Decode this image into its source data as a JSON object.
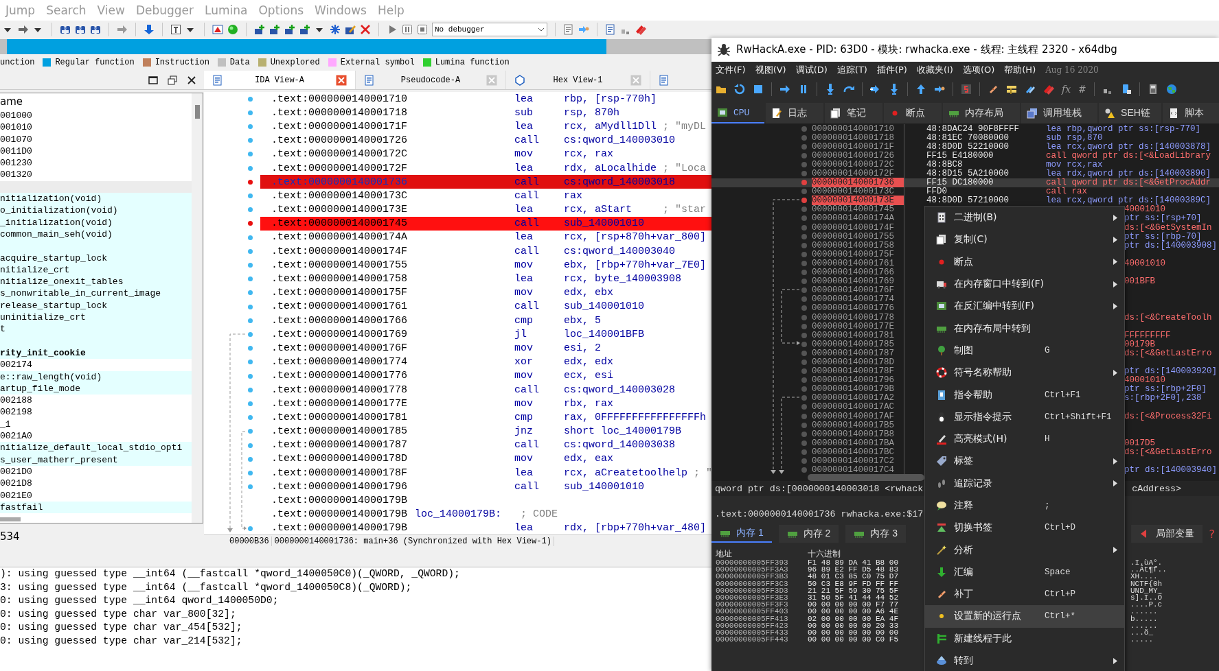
{
  "ida": {
    "menu": [
      "Jump",
      "Search",
      "View",
      "Debugger",
      "Lumina",
      "Options",
      "Windows",
      "Help"
    ],
    "debugger_select": "No debugger",
    "legend": [
      {
        "label": "unction"
      },
      {
        "label": "Regular function",
        "color": "#00a0e0"
      },
      {
        "label": "Instruction",
        "color": "#c0805c"
      },
      {
        "label": "Data",
        "color": "#c0c0c0"
      },
      {
        "label": "Unexplored",
        "color": "#b8b070"
      },
      {
        "label": "External symbol",
        "color": "#ffa8ff"
      },
      {
        "label": "Lumina function",
        "color": "#30d030"
      }
    ],
    "functions_panel": {
      "header": "ame",
      "status": "534",
      "rows": [
        {
          "text": "001000",
          "library": false,
          "selected": false,
          "bold": false
        },
        {
          "text": "001010",
          "library": false,
          "selected": false,
          "bold": false
        },
        {
          "text": "001070",
          "library": false,
          "selected": false,
          "bold": false
        },
        {
          "text": "0011D0",
          "library": false,
          "selected": false,
          "bold": false
        },
        {
          "text": "001230",
          "library": false,
          "selected": false,
          "bold": false
        },
        {
          "text": "001320",
          "library": false,
          "selected": false,
          "bold": false
        },
        {
          "library": false,
          "selected": true,
          "bold": false
        },
        {
          "text": "nitialization(void)",
          "library": true,
          "selected": false,
          "bold": false
        },
        {
          "text": "o_initialization(void)",
          "library": true,
          "selected": false,
          "bold": false
        },
        {
          "text": "_initialization(void)",
          "library": true,
          "selected": false,
          "bold": false
        },
        {
          "text": "common_main_seh(void)",
          "library": true,
          "selected": false,
          "bold": false
        },
        {
          "library": true,
          "selected": false,
          "bold": false
        },
        {
          "text": "acquire_startup_lock",
          "library": true,
          "selected": false,
          "bold": false
        },
        {
          "text": "nitialize_crt",
          "library": true,
          "selected": false,
          "bold": false
        },
        {
          "text": "nitialize_onexit_tables",
          "library": true,
          "selected": false,
          "bold": false
        },
        {
          "text": "s_nonwritable_in_current_image",
          "library": true,
          "selected": false,
          "bold": false
        },
        {
          "text": "release_startup_lock",
          "library": true,
          "selected": false,
          "bold": false
        },
        {
          "text": "uninitialize_crt",
          "library": true,
          "selected": false,
          "bold": false
        },
        {
          "text": "t",
          "library": true,
          "selected": false,
          "bold": false
        },
        {
          "library": true,
          "selected": false,
          "bold": false
        },
        {
          "text": "rity_init_cookie",
          "library": true,
          "selected": false,
          "bold": true
        },
        {
          "text": "002174",
          "library": false,
          "selected": false,
          "bold": false
        },
        {
          "text": "e::raw_length(void)",
          "library": true,
          "selected": false,
          "bold": false
        },
        {
          "text": "artup_file_mode",
          "library": true,
          "selected": false,
          "bold": false
        },
        {
          "text": "002188",
          "library": false,
          "selected": false,
          "bold": false
        },
        {
          "text": "002198",
          "library": false,
          "selected": false,
          "bold": false
        },
        {
          "text": "_1",
          "library": false,
          "selected": false,
          "bold": false
        },
        {
          "text": "0021A0",
          "library": false,
          "selected": false,
          "bold": false
        },
        {
          "text": "nitialize_default_local_stdio_opti",
          "library": true,
          "selected": false,
          "bold": false
        },
        {
          "text": "s_user_matherr_present",
          "library": true,
          "selected": false,
          "bold": false
        },
        {
          "text": "0021D0",
          "library": false,
          "selected": false,
          "bold": false
        },
        {
          "text": "0021D8",
          "library": false,
          "selected": false,
          "bold": false
        },
        {
          "text": "0021E0",
          "library": false,
          "selected": false,
          "bold": false
        },
        {
          "text": "fastfail",
          "library": true,
          "selected": false,
          "bold": false
        }
      ]
    },
    "tabs": [
      {
        "label": "IDA View-A",
        "selected": true
      },
      {
        "label": "Pseudocode-A",
        "selected": false
      },
      {
        "label": "Hex View-1",
        "selected": false
      },
      {
        "selected": false
      }
    ],
    "listing": [
      {
        "address": ".text:0000000140001710",
        "mnemonic": "lea",
        "operand": "rbp, [rsp-770h]",
        "breakpoint": false,
        "selected": false
      },
      {
        "address": ".text:0000000140001718",
        "mnemonic": "sub",
        "operand": "rsp, 870h",
        "breakpoint": false,
        "selected": false
      },
      {
        "address": ".text:000000014000171F",
        "mnemonic": "lea",
        "operand": "rcx, aMydll1Dll",
        "comment": "; \"myDL",
        "breakpoint": false,
        "selected": false
      },
      {
        "address": ".text:0000000140001726",
        "mnemonic": "call",
        "operand": "cs:qword_140003010",
        "breakpoint": false,
        "selected": false
      },
      {
        "address": ".text:000000014000172C",
        "mnemonic": "mov",
        "operand": "rcx, rax",
        "breakpoint": false,
        "selected": false
      },
      {
        "address": ".text:000000014000172F",
        "mnemonic": "lea",
        "operand": "rdx, aLocalhide",
        "comment": "; \"Loca",
        "breakpoint": false,
        "selected": false
      },
      {
        "address": ".text:0000000140001736",
        "mnemonic": "call",
        "operand": "cs:qword_140003018",
        "breakpoint": true,
        "selected": true
      },
      {
        "address": ".text:000000014000173C",
        "mnemonic": "call",
        "operand": "rax",
        "breakpoint": false,
        "selected": false
      },
      {
        "address": ".text:000000014000173E",
        "mnemonic": "lea",
        "operand": "rcx, aStart",
        "comment": "; \"star",
        "breakpoint": false,
        "selected": false
      },
      {
        "address": ".text:0000000140001745",
        "mnemonic": "call",
        "operand": "sub_140001010",
        "breakpoint": true,
        "selected": false
      },
      {
        "address": ".text:000000014000174A",
        "mnemonic": "lea",
        "operand": "rcx, [rsp+870h+var_800]",
        "breakpoint": false,
        "selected": false
      },
      {
        "address": ".text:000000014000174F",
        "mnemonic": "call",
        "operand": "cs:qword_140003040",
        "breakpoint": false,
        "selected": false
      },
      {
        "address": ".text:0000000140001755",
        "mnemonic": "mov",
        "operand": "ebx, [rbp+770h+var_7E0]",
        "breakpoint": false,
        "selected": false
      },
      {
        "address": ".text:0000000140001758",
        "mnemonic": "lea",
        "operand": "rcx, byte_140003908",
        "breakpoint": false,
        "selected": false
      },
      {
        "address": ".text:000000014000175F",
        "mnemonic": "mov",
        "operand": "edx, ebx",
        "breakpoint": false,
        "selected": false
      },
      {
        "address": ".text:0000000140001761",
        "mnemonic": "call",
        "operand": "sub_140001010",
        "breakpoint": false,
        "selected": false
      },
      {
        "address": ".text:0000000140001766",
        "mnemonic": "cmp",
        "operand": "ebx, 5",
        "breakpoint": false,
        "selected": false
      },
      {
        "address": ".text:0000000140001769",
        "mnemonic": "jl",
        "operand": "loc_140001BFB",
        "breakpoint": false,
        "selected": false
      },
      {
        "address": ".text:000000014000176F",
        "mnemonic": "mov",
        "operand": "esi, 2",
        "breakpoint": false,
        "selected": false
      },
      {
        "address": ".text:0000000140001774",
        "mnemonic": "xor",
        "operand": "edx, edx",
        "breakpoint": false,
        "selected": false
      },
      {
        "address": ".text:0000000140001776",
        "mnemonic": "mov",
        "operand": "ecx, esi",
        "breakpoint": false,
        "selected": false
      },
      {
        "address": ".text:0000000140001778",
        "mnemonic": "call",
        "operand": "cs:qword_140003028",
        "breakpoint": false,
        "selected": false
      },
      {
        "address": ".text:000000014000177E",
        "mnemonic": "mov",
        "operand": "rbx, rax",
        "breakpoint": false,
        "selected": false
      },
      {
        "address": ".text:0000000140001781",
        "mnemonic": "cmp",
        "operand": "rax, 0FFFFFFFFFFFFFFFFh",
        "breakpoint": false,
        "selected": false
      },
      {
        "address": ".text:0000000140001785",
        "mnemonic": "jnz",
        "operand": "short loc_14000179B",
        "breakpoint": false,
        "selected": false
      },
      {
        "address": ".text:0000000140001787",
        "mnemonic": "call",
        "operand": "cs:qword_140003038",
        "breakpoint": false,
        "selected": false
      },
      {
        "address": ".text:000000014000178D",
        "mnemonic": "mov",
        "operand": "edx, eax",
        "breakpoint": false,
        "selected": false
      },
      {
        "address": ".text:000000014000178F",
        "mnemonic": "lea",
        "operand": "rcx, aCreatetoolhelp",
        "comment": "; \"",
        "breakpoint": false,
        "selected": false
      },
      {
        "address": ".text:0000000140001796",
        "mnemonic": "call",
        "operand": "sub_140001010",
        "breakpoint": false,
        "selected": false
      },
      {
        "address": ".text:000000014000179B",
        "breakpoint": false,
        "selected": false
      },
      {
        "address": ".text:000000014000179B",
        "label": "loc_14000179B:",
        "comment": "; CODE",
        "breakpoint": false,
        "selected": false
      },
      {
        "address": ".text:000000014000179B",
        "mnemonic": "lea",
        "operand": "rdx, [rbp+770h+var_480]",
        "breakpoint": false,
        "selected": false
      }
    ],
    "status": [
      "00000B36",
      "0000000140001736: main+36 (Synchronized with Hex View-1)"
    ],
    "output": [
      "): using guessed type __int64 (__fastcall *qword_1400050C0)(_QWORD, _QWORD);",
      "3: using guessed type __int64 (__fastcall *qword_1400050C8)(_QWORD);",
      "0: using guessed type __int64 qword_1400050D0;",
      "0: using guessed type char var_800[32];",
      "0: using guessed type char var_454[532];",
      "0: using guessed type char var_214[532];"
    ]
  },
  "x64dbg": {
    "title": "RwHackA.exe - PID: 63D0 - 模块: rwhacka.exe - 线程: 主线程 2320 - x64dbg",
    "menu": [
      "文件(F)",
      "视图(V)",
      "调试(D)",
      "追踪(T)",
      "插件(P)",
      "收藏夹(I)",
      "选项(O)",
      "帮助(H)"
    ],
    "build_date": "Aug 16 2020",
    "toolbar_glyphs": [
      "fx",
      "#"
    ],
    "tabs": [
      {
        "label": "CPU",
        "selected": true
      },
      {
        "label": "日志",
        "selected": false
      },
      {
        "label": "笔记",
        "selected": false
      },
      {
        "label": "断点",
        "selected": false
      },
      {
        "label": "内存布局",
        "selected": false
      },
      {
        "label": "调用堆栈",
        "selected": false
      },
      {
        "label": "SEH链",
        "selected": false
      },
      {
        "label": "脚本",
        "selected": false
      }
    ],
    "disassembly": [
      {
        "address": "0000000140001710",
        "bytes": "48:8DAC24 90F8FFFF",
        "instruction": "lea rbp,qword ptr ss:[rsp-770]",
        "kind": "normal",
        "breakpoint": false,
        "selected": false
      },
      {
        "address": "0000000140001718",
        "bytes": "48:81EC 70080000",
        "instruction": "sub rsp,870",
        "kind": "normal",
        "breakpoint": false,
        "selected": false
      },
      {
        "address": "000000014000171F",
        "bytes": "48:8D0D 52210000",
        "instruction": "lea rcx,qword ptr ds:[140003878]",
        "kind": "normal",
        "breakpoint": false,
        "selected": false
      },
      {
        "address": "0000000140001726",
        "bytes": "FF15 E4180000",
        "instruction": "call qword ptr ds:[<&LoadLibrary",
        "kind": "call",
        "breakpoint": false,
        "selected": false
      },
      {
        "address": "000000014000172C",
        "bytes": "48:8BC8",
        "instruction": "mov rcx,rax",
        "kind": "normal",
        "breakpoint": false,
        "selected": false
      },
      {
        "address": "000000014000172F",
        "bytes": "48:8D15 5A210000",
        "instruction": "lea rdx,qword ptr ds:[140003890]",
        "kind": "normal",
        "breakpoint": false,
        "selected": false
      },
      {
        "address": "0000000140001736",
        "bytes": "FF15 DC180000",
        "instruction": "call qword ptr ds:[<&GetProcAddr",
        "kind": "call",
        "breakpoint": true,
        "selected": true
      },
      {
        "address": "000000014000173C",
        "bytes": "FFD0",
        "instruction": "call rax",
        "kind": "call",
        "breakpoint": false,
        "selected": false
      },
      {
        "address": "000000014000173E",
        "bytes": "48:8D0D 57210000",
        "instruction": "lea rcx,qword ptr ds:[14000389C]",
        "kind": "normal",
        "breakpoint": true,
        "selected": false
      },
      {
        "address": "0000000140001745",
        "tail": "40001010",
        "kind": "call",
        "breakpoint": false,
        "selected": false
      },
      {
        "address": "000000014000174A",
        "tail": "ptr ss:[rsp+70]",
        "kind": "normal",
        "breakpoint": false,
        "selected": false
      },
      {
        "address": "000000014000174F",
        "tail": "ds:[<&GetSystemIn",
        "kind": "call",
        "breakpoint": false,
        "selected": false
      },
      {
        "address": "0000000140001755",
        "tail": "ptr ss:[rbp-70]",
        "kind": "normal",
        "breakpoint": false,
        "selected": false
      },
      {
        "address": "0000000140001758",
        "tail": "ptr ds:[140003908]",
        "kind": "normal",
        "breakpoint": false,
        "selected": false
      },
      {
        "address": "000000014000175F",
        "breakpoint": false,
        "selected": false
      },
      {
        "address": "0000000140001761",
        "tail": "40001010",
        "kind": "call",
        "breakpoint": false,
        "selected": false
      },
      {
        "address": "0000000140001766",
        "breakpoint": false,
        "selected": false
      },
      {
        "address": "0000000140001769",
        "tail": "001BFB",
        "kind": "call",
        "breakpoint": false,
        "selected": false
      },
      {
        "address": "000000014000176F",
        "breakpoint": false,
        "selected": false
      },
      {
        "address": "0000000140001774",
        "breakpoint": false,
        "selected": false
      },
      {
        "address": "0000000140001776",
        "breakpoint": false,
        "selected": false
      },
      {
        "address": "0000000140001778",
        "tail": "ds:[<&CreateToolh",
        "kind": "call",
        "breakpoint": false,
        "selected": false
      },
      {
        "address": "000000014000177E",
        "breakpoint": false,
        "selected": false
      },
      {
        "address": "0000000140001781",
        "tail": "FFFFFFFFF",
        "kind": "call",
        "breakpoint": false,
        "selected": false
      },
      {
        "address": "0000000140001785",
        "tail": "00179B",
        "kind": "call",
        "breakpoint": false,
        "selected": false
      },
      {
        "address": "0000000140001787",
        "tail": "ds:[<&GetLastErro",
        "kind": "call",
        "breakpoint": false,
        "selected": false
      },
      {
        "address": "000000014000178D",
        "breakpoint": false,
        "selected": false
      },
      {
        "address": "000000014000178F",
        "tail": "ptr ds:[140003920]",
        "kind": "normal",
        "breakpoint": false,
        "selected": false
      },
      {
        "address": "0000000140001796",
        "tail": "40001010",
        "kind": "call",
        "breakpoint": false,
        "selected": false
      },
      {
        "address": "000000014000179B",
        "tail": "ptr ss:[rbp+2F0]",
        "kind": "normal",
        "breakpoint": false,
        "selected": false
      },
      {
        "address": "00000001400017A2",
        "tail": "s:[rbp+2F0],238",
        "kind": "normal",
        "breakpoint": false,
        "selected": false
      },
      {
        "address": "00000001400017AC",
        "breakpoint": false,
        "selected": false
      },
      {
        "address": "00000001400017AF",
        "tail": "ds:[<&Process32Fi",
        "kind": "call",
        "breakpoint": false,
        "selected": false
      },
      {
        "address": "00000001400017B5",
        "breakpoint": false,
        "selected": false
      },
      {
        "address": "00000001400017B8",
        "breakpoint": false,
        "selected": false
      },
      {
        "address": "00000001400017BA",
        "tail": "0017D5",
        "kind": "call",
        "breakpoint": false,
        "selected": false
      },
      {
        "address": "00000001400017BC",
        "tail": "ds:[<&GetLastErro",
        "kind": "call",
        "breakpoint": false,
        "selected": false
      },
      {
        "address": "00000001400017C2",
        "breakpoint": false,
        "selected": false
      },
      {
        "address": "00000001400017C4",
        "tail": "ptr ds:[140003940]",
        "kind": "normal",
        "breakpoint": false,
        "selected": false
      }
    ],
    "info": {
      "left": "qword ptr ds:[0000000140003018 <rwhack",
      "right": "cAddress>"
    },
    "location": ".text:0000000140001736 rwhacka.exe:$17",
    "memory_tabs": [
      {
        "label": "内存 1",
        "selected": true
      },
      {
        "label": "内存 2",
        "selected": false
      },
      {
        "label": "内存 3",
        "selected": false
      }
    ],
    "side_tab": {
      "label": "局部变量",
      "selected": false
    },
    "side_glyph": "?",
    "dump": {
      "columns": [
        "地址",
        "十六进制"
      ],
      "rows": [
        {
          "address": "00000000005FF393",
          "hex": "F1 48 89 DA 41 B8 00",
          "ascii": ".I.ùA°."
        },
        {
          "address": "00000000005FF3A3",
          "hex": "96 89 E2 FF D5 48 83",
          "ascii": "..Ât¶f.."
        },
        {
          "address": "00000000005FF3B3",
          "hex": "48 01 C3 85 C0 75 D7",
          "ascii": "XH...."
        },
        {
          "address": "00000000005FF3C3",
          "hex": "50 C3 E8 9F FD FF FF",
          "ascii": "NCTF{0h"
        },
        {
          "address": "00000000005FF3D3",
          "hex": "21 21 5F 59 30 75 5F",
          "ascii": "UND_MY_"
        },
        {
          "address": "00000000005FF3E3",
          "hex": "31 50 5F 41 44 44 52",
          "ascii": "s].I..Õ"
        },
        {
          "address": "00000000005FF3F3",
          "hex": "00 00 00 00 00 F7 77",
          "ascii": "....P.c"
        },
        {
          "address": "00000000005FF403",
          "hex": "00 00 00 00 00 A6 4E",
          "ascii": "......"
        },
        {
          "address": "00000000005FF413",
          "hex": "02 00 00 00 00 EA 4F",
          "ascii": "b....."
        },
        {
          "address": "00000000005FF423",
          "hex": "00 00 00 00 00 20 33",
          "ascii": "......"
        },
        {
          "address": "00000000005FF433",
          "hex": "00 00 00 00 00 00 00",
          "ascii": "...õ_"
        },
        {
          "address": "00000000005FF443",
          "hex": "00 00 00 00 00 C0 F5",
          "ascii": "....."
        }
      ]
    },
    "context_menu": [
      {
        "label": "二进制(B)",
        "submenu": true,
        "selected": false
      },
      {
        "label": "复制(C)",
        "submenu": true,
        "selected": false
      },
      {
        "label": "断点",
        "submenu": true,
        "selected": false
      },
      {
        "label": "在内存窗口中转到(F)",
        "submenu": true,
        "selected": false
      },
      {
        "label": "在反汇编中转到(F)",
        "submenu": true,
        "selected": false
      },
      {
        "label": "在内存布局中转到",
        "submenu": false,
        "selected": false
      },
      {
        "label": "制图",
        "shortcut": "G",
        "submenu": false,
        "selected": false
      },
      {
        "label": "符号名称帮助",
        "submenu": true,
        "selected": false
      },
      {
        "label": "指令帮助",
        "shortcut": "Ctrl+F1",
        "submenu": false,
        "selected": false
      },
      {
        "label": "显示指令提示",
        "shortcut": "Ctrl+Shift+F1",
        "submenu": false,
        "selected": false
      },
      {
        "label": "高亮模式(H)",
        "shortcut": "H",
        "submenu": false,
        "selected": false
      },
      {
        "label": "标签",
        "submenu": true,
        "selected": false
      },
      {
        "label": "追踪记录",
        "submenu": true,
        "selected": false
      },
      {
        "label": "注释",
        "shortcut": ";",
        "submenu": false,
        "selected": false
      },
      {
        "label": "切换书签",
        "shortcut": "Ctrl+D",
        "submenu": false,
        "selected": false
      },
      {
        "label": "分析",
        "submenu": true,
        "selected": false
      },
      {
        "label": "汇编",
        "shortcut": "Space",
        "submenu": false,
        "selected": false
      },
      {
        "label": "补丁",
        "shortcut": "Ctrl+P",
        "submenu": false,
        "selected": false
      },
      {
        "label": "设置新的运行点",
        "shortcut": "Ctrl+*",
        "submenu": false,
        "selected": true
      },
      {
        "label": "新建线程于此",
        "submenu": false,
        "selected": false
      },
      {
        "label": "转到",
        "submenu": true,
        "selected": false
      }
    ]
  }
}
